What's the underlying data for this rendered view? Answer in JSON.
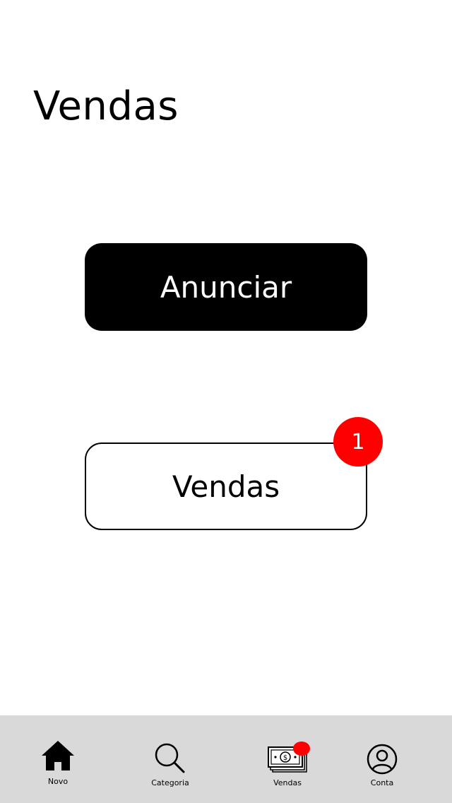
{
  "header": {
    "title": "Vendas"
  },
  "actions": {
    "announce_label": "Anunciar",
    "sales_label": "Vendas",
    "sales_badge_count": "1"
  },
  "tabbar": {
    "items": [
      {
        "label": "Novo",
        "icon": "home-icon"
      },
      {
        "label": "Categoria",
        "icon": "search-icon"
      },
      {
        "label": "Vendas",
        "icon": "money-icon"
      },
      {
        "label": "Conta",
        "icon": "user-icon"
      }
    ]
  },
  "colors": {
    "accent": "#ff0000",
    "primary_button": "#000000",
    "tabbar_bg": "#d9d9d9"
  }
}
